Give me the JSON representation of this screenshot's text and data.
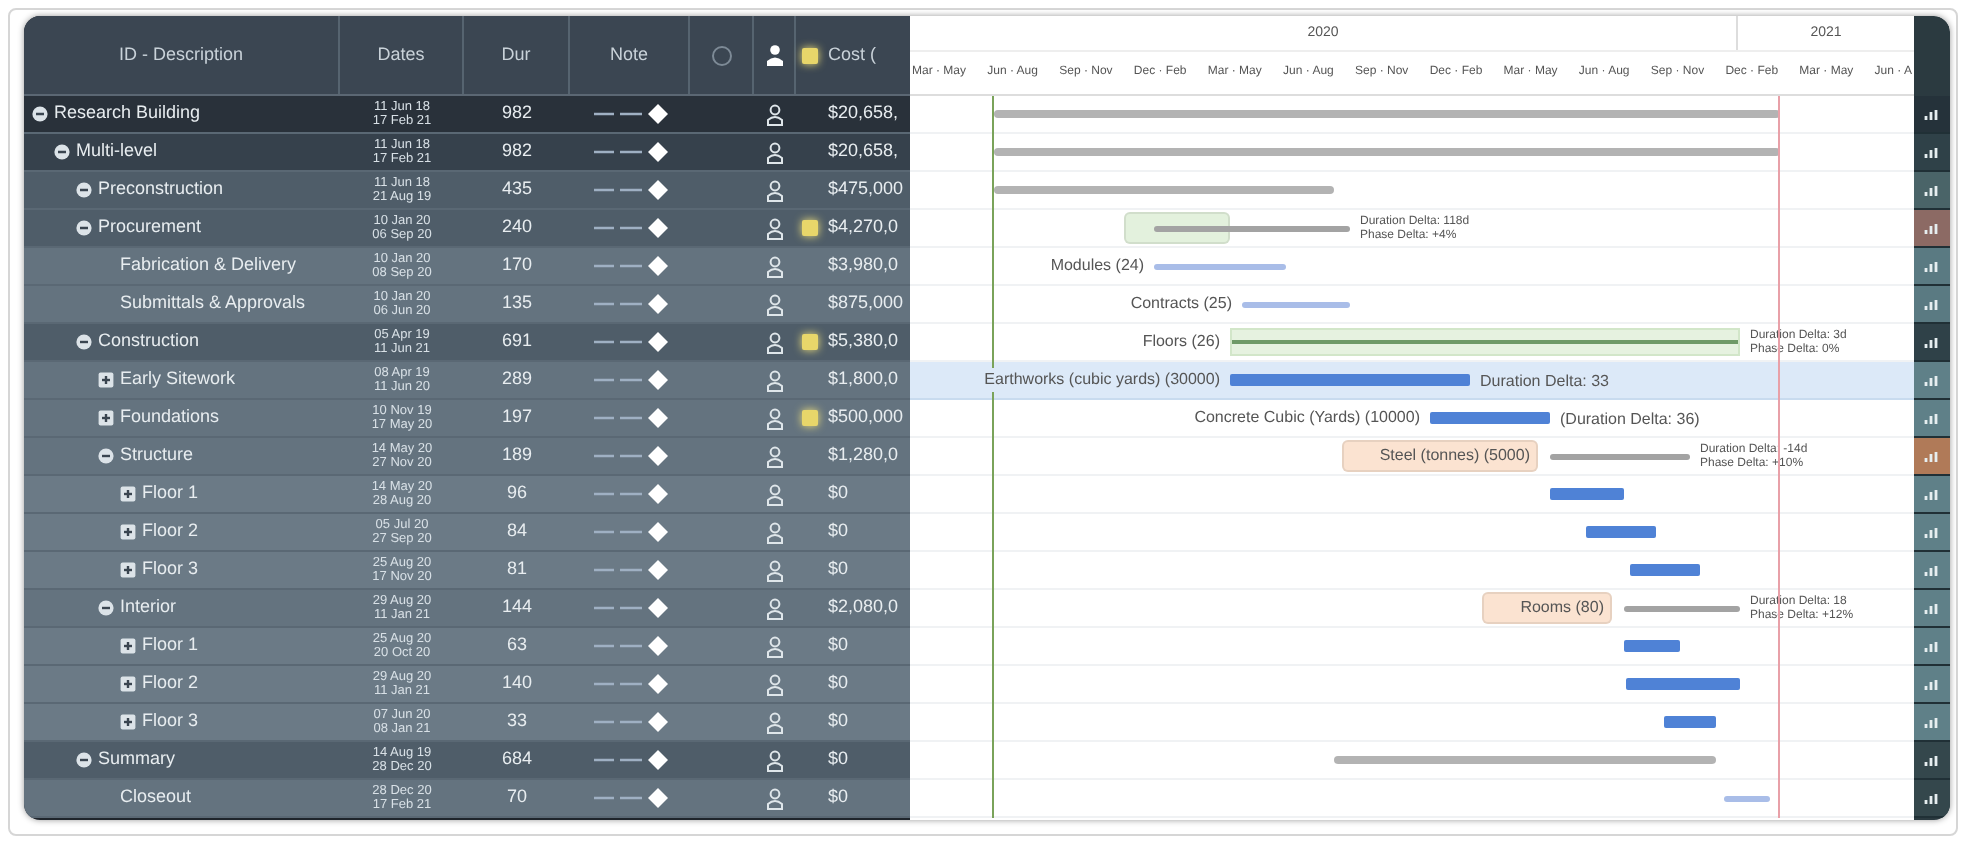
{
  "table": {
    "columns": [
      "ID - Description",
      "Dates",
      "Dur",
      "Note",
      "Cost ("
    ],
    "rows": [
      {
        "name": "Research Building",
        "start": "11 Jun 18",
        "end": "17 Feb 21",
        "dur": "982",
        "cost": "$20,658,",
        "note": false,
        "expanded": true,
        "children": [
          {
            "name": "Multi-level",
            "start": "11 Jun 18",
            "end": "17 Feb 21",
            "dur": "982",
            "cost": "$20,658,",
            "note": false,
            "expanded": true,
            "children": [
              {
                "name": "Preconstruction",
                "start": "11 Jun 18",
                "end": "21 Aug 19",
                "dur": "435",
                "cost": "$475,000",
                "note": false,
                "expanded": true
              },
              {
                "name": "Procurement",
                "start": "10 Jan 20",
                "end": "06 Sep 20",
                "dur": "240",
                "cost": "$4,270,0",
                "note": true,
                "expanded": true,
                "children": [
                  {
                    "name": "Fabrication & Delivery",
                    "start": "10 Jan 20",
                    "end": "08 Sep 20",
                    "dur": "170",
                    "cost": "$3,980,0",
                    "note": false
                  },
                  {
                    "name": "Submittals & Approvals",
                    "start": "10 Jan 20",
                    "end": "06 Jun 20",
                    "dur": "135",
                    "cost": "$875,000",
                    "note": false
                  }
                ]
              },
              {
                "name": "Construction",
                "start": "05 Apr 19",
                "end": "11 Jun 21",
                "dur": "691",
                "cost": "$5,380,0",
                "note": true,
                "expanded": true,
                "children": [
                  {
                    "name": "Early Sitework",
                    "start": "08 Apr 19",
                    "end": "11 Jun 20",
                    "dur": "289",
                    "cost": "$1,800,0",
                    "note": false,
                    "expanded": false
                  },
                  {
                    "name": "Foundations",
                    "start": "10 Nov 19",
                    "end": "17 May 20",
                    "dur": "197",
                    "cost": "$500,000",
                    "note": true,
                    "expanded": false
                  },
                  {
                    "name": "Structure",
                    "start": "14 May 20",
                    "end": "27 Nov 20",
                    "dur": "189",
                    "cost": "$1,280,0",
                    "note": false,
                    "expanded": true,
                    "children": [
                      {
                        "name": "Floor 1",
                        "start": "14 May 20",
                        "end": "28 Aug 20",
                        "dur": "96",
                        "cost": "$0",
                        "note": false,
                        "expanded": false
                      },
                      {
                        "name": "Floor 2",
                        "start": "05 Jul 20",
                        "end": "27 Sep 20",
                        "dur": "84",
                        "cost": "$0",
                        "note": false,
                        "expanded": false
                      },
                      {
                        "name": "Floor 3",
                        "start": "25 Aug 20",
                        "end": "17 Nov 20",
                        "dur": "81",
                        "cost": "$0",
                        "note": false,
                        "expanded": false
                      }
                    ]
                  },
                  {
                    "name": "Interior",
                    "start": "29 Aug 20",
                    "end": "11 Jan 21",
                    "dur": "144",
                    "cost": "$2,080,0",
                    "note": false,
                    "expanded": true,
                    "children": [
                      {
                        "name": "Floor 1",
                        "start": "25 Aug 20",
                        "end": "20 Oct 20",
                        "dur": "63",
                        "cost": "$0",
                        "note": false,
                        "expanded": false
                      },
                      {
                        "name": "Floor 2",
                        "start": "29 Aug 20",
                        "end": "11 Jan 21",
                        "dur": "140",
                        "cost": "$0",
                        "note": false,
                        "expanded": false
                      },
                      {
                        "name": "Floor 3",
                        "start": "07 Jun 20",
                        "end": "08 Jan 21",
                        "dur": "33",
                        "cost": "$0",
                        "note": false,
                        "expanded": false
                      }
                    ]
                  }
                ]
              },
              {
                "name": "Summary",
                "start": "14 Aug 19",
                "end": "28 Dec 20",
                "dur": "684",
                "cost": "$0",
                "note": false,
                "expanded": true,
                "children": [
                  {
                    "name": "Closeout",
                    "start": "28 Dec 20",
                    "end": "17 Feb 21",
                    "dur": "70",
                    "cost": "$0",
                    "note": false
                  }
                ]
              }
            ]
          }
        ]
      }
    ]
  },
  "gantt": {
    "years": [
      "2020",
      "2021"
    ],
    "months": [
      "Mar · May",
      "Jun · Aug",
      "Sep · Nov",
      "Dec · Feb",
      "Mar · May",
      "Jun · Aug",
      "Sep · Nov",
      "Dec · Feb",
      "Mar · May",
      "Jun · Aug",
      "Sep · Nov",
      "Dec · Feb",
      "Mar · May",
      "Jun · A"
    ],
    "rows": [
      {
        "kind": "summary",
        "selected": false,
        "color": "#25323a"
      },
      {
        "kind": "summary",
        "selected": false,
        "color": "#2f4148"
      },
      {
        "kind": "summary",
        "selected": false,
        "color": "#4a6468"
      },
      {
        "kind": "phase",
        "selected": false,
        "color": "#8c6a64",
        "highlight": {
          "color": "#e3f1dd"
        },
        "notes": [
          "Duration Delta: 118d",
          "Phase Delta: +4%"
        ]
      },
      {
        "kind": "task",
        "selected": false,
        "color": "#5a7a82",
        "label": "Modules (24)"
      },
      {
        "kind": "task",
        "selected": false,
        "color": "#5a7a82",
        "label": "Contracts (25)"
      },
      {
        "kind": "band",
        "selected": false,
        "color": "#2f4148",
        "label": "Floors (26)",
        "notes": [
          "Duration Delta: 3d",
          "Phase Delta: 0%"
        ]
      },
      {
        "kind": "progress",
        "selected": true,
        "color": "#5f8088",
        "label": "Earthworks (cubic yards) (30000)",
        "notes": [
          "Duration Delta: 33"
        ]
      },
      {
        "kind": "progress",
        "selected": false,
        "color": "#5f8088",
        "label": "Concrete Cubic (Yards) (10000)",
        "notes": [
          "(Duration Delta: 36)"
        ]
      },
      {
        "kind": "phase",
        "selected": false,
        "color": "#b07a58",
        "highlight": {
          "color": "#fbe3d1"
        },
        "label": "Steel (tonnes) (5000)",
        "notes": [
          "Duration Delta: -14d",
          "Phase Delta: +10%"
        ]
      },
      {
        "kind": "progress",
        "selected": false,
        "color": "#5f8088"
      },
      {
        "kind": "progress",
        "selected": false,
        "color": "#5f8088"
      },
      {
        "kind": "progress",
        "selected": false,
        "color": "#5f8088"
      },
      {
        "kind": "phase",
        "selected": false,
        "color": "#5f8088",
        "highlight": {
          "color": "#fbe3d1"
        },
        "label": "Rooms (80)",
        "notes": [
          "Duration Delta: 18",
          "Phase Delta: +12%"
        ]
      },
      {
        "kind": "progress",
        "selected": false,
        "color": "#5f8088"
      },
      {
        "kind": "progress",
        "selected": false,
        "color": "#5f8088"
      },
      {
        "kind": "progress",
        "selected": false,
        "color": "#5f8088"
      },
      {
        "kind": "summary",
        "selected": false,
        "color": "#34474c"
      },
      {
        "kind": "task",
        "selected": false,
        "color": "#34474c"
      }
    ]
  }
}
